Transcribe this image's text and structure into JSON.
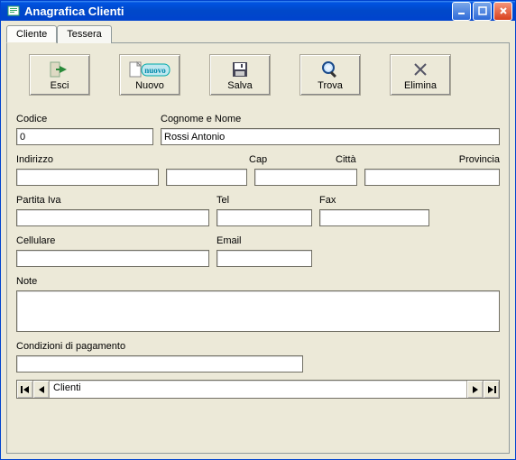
{
  "window": {
    "title": "Anagrafica Clienti"
  },
  "tabs": {
    "cliente": "Cliente",
    "tessera": "Tessera"
  },
  "toolbar": {
    "esci": "Esci",
    "nuovo": "Nuovo",
    "salva": "Salva",
    "trova": "Trova",
    "elimina": "Elimina",
    "nuovo_tag": "nuovo"
  },
  "labels": {
    "codice": "Codice",
    "cognome_nome": "Cognome e Nome",
    "indirizzo": "Indirizzo",
    "cap": "Cap",
    "citta": "Città",
    "provincia": "Provincia",
    "partita_iva": "Partita Iva",
    "tel": "Tel",
    "fax": "Fax",
    "cellulare": "Cellulare",
    "email": "Email",
    "note": "Note",
    "condizioni": "Condizioni di pagamento"
  },
  "fields": {
    "codice": "0",
    "cognome_nome": "Rossi Antonio",
    "indirizzo": "",
    "cap": "",
    "citta": "",
    "provincia": "",
    "partita_iva": "",
    "tel": "",
    "fax": "",
    "cellulare": "",
    "email": "",
    "note": "",
    "condizioni": ""
  },
  "nav": {
    "label": "Clienti"
  }
}
